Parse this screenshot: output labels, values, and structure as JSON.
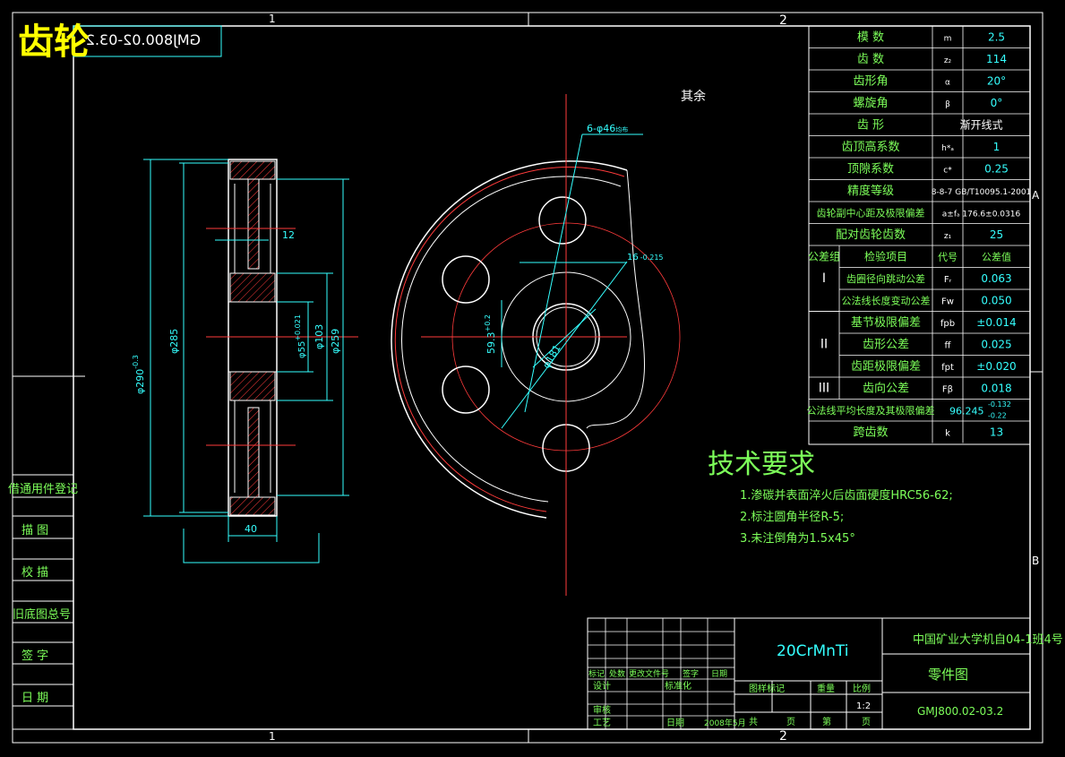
{
  "title_stamp": {
    "title": "齿轮",
    "mirrored_code": "GMJ800.02-03.2"
  },
  "zones": {
    "col1": "1",
    "col2": "2",
    "rowA": "A",
    "rowB": "B"
  },
  "surface_note": "其余",
  "params": [
    {
      "name": "模  数",
      "sym": "m",
      "val": "2.5"
    },
    {
      "name": "齿  数",
      "sym": "z₂",
      "val": "114"
    },
    {
      "name": "齿形角",
      "sym": "α",
      "val": "20°"
    },
    {
      "name": "螺旋角",
      "sym": "β",
      "val": "0°"
    },
    {
      "name": "齿  形",
      "sym": "",
      "val": "渐开线式"
    },
    {
      "name": "齿顶高系数",
      "sym": "h*ₐ",
      "val": "1"
    },
    {
      "name": "顶隙系数",
      "sym": "c*",
      "val": "0.25"
    },
    {
      "name": "精度等级",
      "sym": "",
      "val": "8-8-7 GB/T10095.1-2001"
    },
    {
      "name": "齿轮副中心距及极限偏差",
      "sym": "",
      "val": "a±fₐ 176.6±0.0316"
    },
    {
      "name": "配对齿轮齿数",
      "sym": "z₁",
      "val": "25"
    }
  ],
  "tolerance_header": {
    "group": "公差组",
    "item": "检验项目",
    "code": "代号",
    "value": "公差值"
  },
  "tolerances": [
    {
      "group": "I",
      "item": "齿圈径向跳动公差",
      "code": "Fᵣ",
      "value": "0.063"
    },
    {
      "group": "",
      "item": "公法线长度变动公差",
      "code": "Fw",
      "value": "0.050"
    },
    {
      "group": "II",
      "item": "基节极限偏差",
      "code": "fpb",
      "value": "±0.014"
    },
    {
      "group": "",
      "item": "齿形公差",
      "code": "ff",
      "value": "0.025"
    },
    {
      "group": "",
      "item": "齿距极限偏差",
      "code": "fpt",
      "value": "±0.020"
    },
    {
      "group": "III",
      "item": "齿向公差",
      "code": "Fβ",
      "value": "0.018"
    }
  ],
  "common_normal": {
    "item": "公法线平均长度及其极限偏差",
    "val": "96.245",
    "upper": "-0.132",
    "lower": "-0.22"
  },
  "span_teeth": {
    "item": "跨齿数",
    "sym": "k",
    "val": "13"
  },
  "tech_req": {
    "title": "技术要求",
    "items": [
      "1.渗碳并表面淬火后齿面硬度HRC56-62;",
      "2.标注圆角半径R-5;",
      "3.未注倒角为1.5x45°"
    ]
  },
  "dims": {
    "d290": "φ290",
    "d290_tol_up": "0",
    "d290_tol_lo": "-0.3",
    "d285": "φ285",
    "bore": "φ55",
    "bore_tol_up": "+0.021",
    "bore_tol_lo": "+0.002",
    "d103": "φ103",
    "d259": "φ259",
    "width": "40",
    "web": "12",
    "keyway": "16",
    "keyway_tol_up": "+0.022",
    "keyway_tol_lo": "-0.215",
    "keyhub": "59.3",
    "keyhub_tol": "+0.2",
    "holes": "6-φ46",
    "holes_suffix": "均布",
    "pcd": "φ181"
  },
  "left_table": [
    "借通用件登记",
    "描  图",
    "校  描",
    "旧底图总号",
    "签  字",
    "日  期"
  ],
  "title_block": {
    "material": "20CrMnTi",
    "school": "中国矿业大学机自04-1班4号",
    "drawing_name": "零件图",
    "drawing_no": "GMJ800.02-03.2",
    "rev_headers": [
      "标记",
      "处数",
      "更改文件号",
      "签字",
      "日期"
    ],
    "sign_labels": [
      "设计",
      "",
      "标准化"
    ],
    "review": "审核",
    "process": "工艺",
    "date_label": "日期",
    "date_val": "2008年5月",
    "stage_headers": [
      "图样标记",
      "重量",
      "比例"
    ],
    "scale": "1:2",
    "sheet": [
      "共",
      "页",
      "第",
      "页"
    ]
  }
}
